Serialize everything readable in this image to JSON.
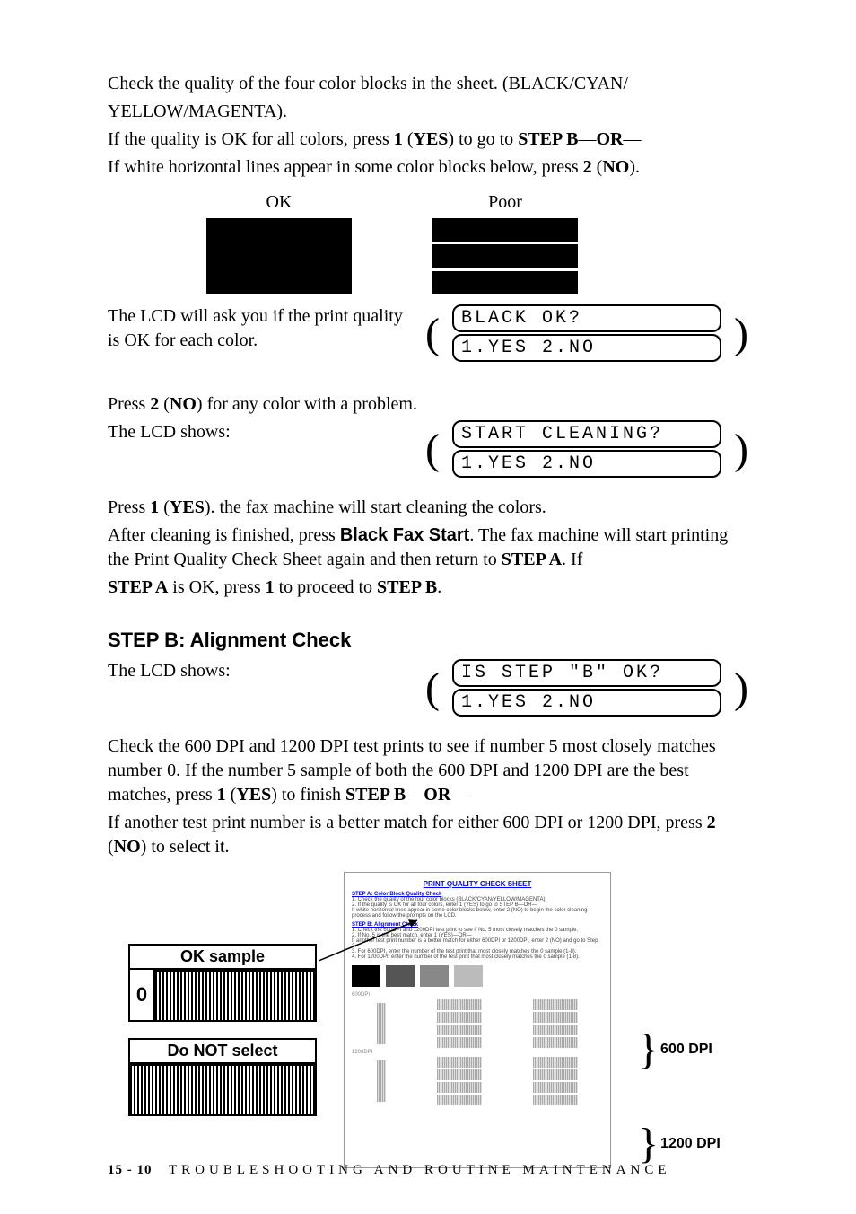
{
  "intro": {
    "p1a": "Check the quality of the four color blocks in the sheet. (BLACK/CYAN/",
    "p1b": "YELLOW/MAGENTA).",
    "p2a": "If the quality is OK for all colors, press ",
    "p2b": "1",
    "p2c": " (",
    "p2d": "YES",
    "p2e": ") to go to ",
    "p2f": "STEP B",
    "p2g": "—",
    "p2h": "OR",
    "p2i": "—",
    "p3a": "If white horizontal lines appear in some color blocks below, press ",
    "p3b": "2",
    "p3c": " (",
    "p3d": "NO",
    "p3e": ")."
  },
  "samples": {
    "ok": "OK",
    "poor": "Poor"
  },
  "lcd_intro": {
    "t1": "The LCD will ask you if the print quality is OK for each color."
  },
  "lcd1": {
    "l1": "BLACK OK?",
    "l2": "1.YES 2.NO"
  },
  "mid": {
    "p1a": "Press ",
    "p1b": "2",
    "p1c": " (",
    "p1d": "NO",
    "p1e": ") for any color with a problem.",
    "p2": "The LCD shows:"
  },
  "lcd2": {
    "l1": "START CLEANING?",
    "l2": "1.YES 2.NO"
  },
  "after": {
    "p1a": "Press ",
    "p1b": "1",
    "p1c": " (",
    "p1d": "YES",
    "p1e": "). the fax machine will start cleaning the colors.",
    "p2a": "After cleaning is finished, press ",
    "p2b": "Black Fax Start",
    "p2c": ". The fax machine will start printing the Print Quality Check Sheet again and then return to ",
    "p2d": "STEP A",
    "p2e": ". If ",
    "p3a": "STEP A",
    "p3b": " is OK, press ",
    "p3c": "1",
    "p3d": " to proceed to ",
    "p3e": "STEP B",
    "p3f": "."
  },
  "stepb": {
    "heading": "STEP B: Alignment Check",
    "p1": "The LCD shows:"
  },
  "lcd3": {
    "l1": "IS STEP \"B\" OK?",
    "l2": "1.YES 2.NO"
  },
  "check": {
    "p1": "Check the 600 DPI and 1200 DPI test prints to see if number 5 most closely matches number 0. If the number 5 sample of both the 600 DPI and 1200 DPI are the best matches, press ",
    "p1b": "1",
    "p1c": " (",
    "p1d": "YES",
    "p1e": ") to finish ",
    "p1f": "STEP B",
    "p1g": "—",
    "p1h": "OR",
    "p1i": "—",
    "p2a": "If another test print number is a better match for either 600 DPI or 1200 DPI, press ",
    "p2b": "2",
    "p2c": " (",
    "p2d": "NO",
    "p2e": ") to select it."
  },
  "diagram": {
    "ok_sample": "OK sample",
    "zero": "0",
    "do_not": "Do NOT select",
    "dpi600": "600 DPI",
    "dpi1200": "1200 DPI",
    "sheet_title": "PRINT QUALITY CHECK SHEET",
    "sheet_secA": "STEP A: Color Block Quality Check",
    "sheet_a1": "1. Check the quality of the four color blocks (BLACK/CYAN/YELLOW/MAGENTA).",
    "sheet_a2": "2. If the quality is OK for all four colors, enter 1 (YES) to go to STEP B—OR—",
    "sheet_a3": "   If white horizontal lines appear in some color blocks below, enter 2 (NO) to begin the color cleaning process and follow the prompts on the LCD.",
    "sheet_secB": "STEP B: Alignment Check",
    "sheet_b1": "1. Check the 600DPI and 1200DPI test print to see if No. 5 most closely matches the 0 sample.",
    "sheet_b2": "2. If No. 5 is the best match, enter 1 (YES)—OR—",
    "sheet_b3": "   If another test print number is a better match for either 600DPI or 1200DPI, enter 2 (NO) and go to Step 3.",
    "sheet_b4": "3. For 600DPI, enter the number of the test print that most closely matches the 0 sample (1-8).",
    "sheet_b5": "4. For 1200DPI, enter the number of the test print that most closely matches the 0 sample (1-8)."
  },
  "footer": {
    "page": "15 - 10",
    "title": "TROUBLESHOOTING AND ROUTINE MAINTENANCE"
  }
}
